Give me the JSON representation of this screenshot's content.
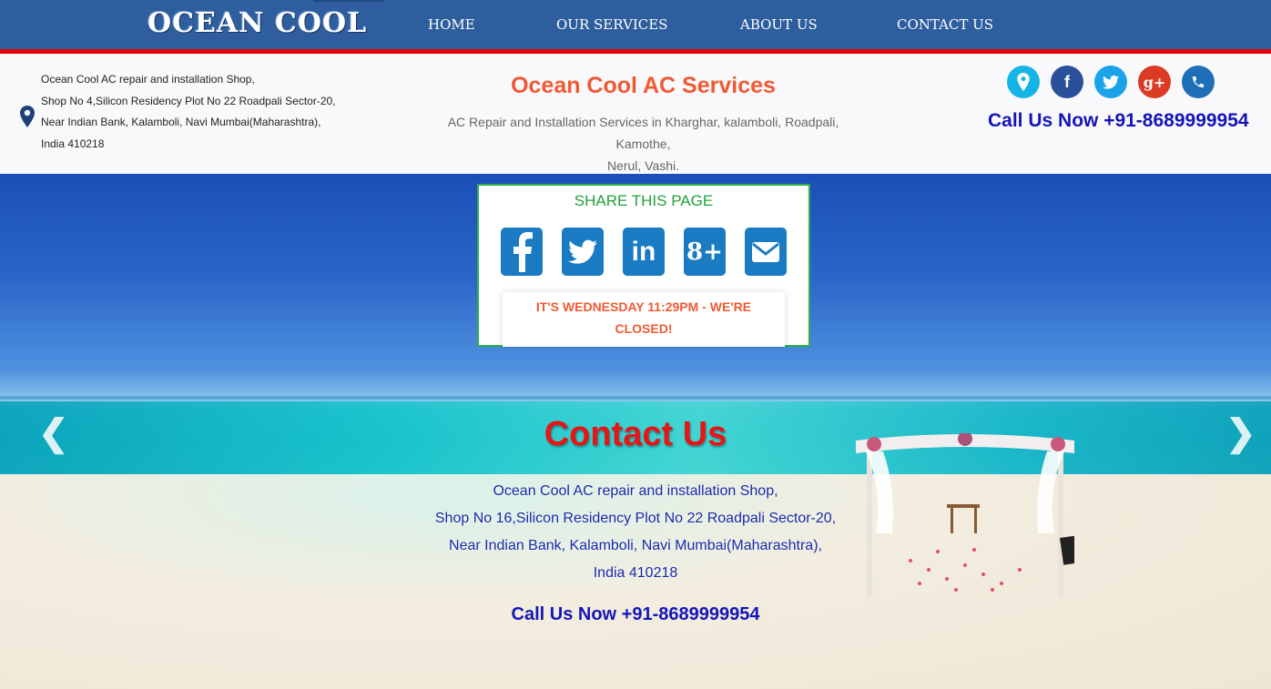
{
  "nav": {
    "logo": "OCEAN COOL",
    "items": [
      "HOME",
      "OUR SERVICES",
      "ABOUT US",
      "CONTACT US"
    ]
  },
  "info": {
    "address_lines": [
      "Ocean Cool AC repair and installation Shop,",
      "Shop No 4,Silicon Residency Plot No 22 Roadpali Sector-20,",
      "Near Indian Bank, Kalamboli, Navi Mumbai(Maharashtra),",
      "India 410218"
    ],
    "title": "Ocean Cool AC Services",
    "subtitle_line1": "AC Repair and Installation Services in Kharghar, kalamboli, Roadpali, Kamothe,",
    "subtitle_line2": "Nerul, Vashi.",
    "call": "Call Us Now +91-8689999954",
    "social_icons": [
      {
        "name": "location-icon",
        "color": "#14b4e6"
      },
      {
        "name": "facebook-icon",
        "color": "#2a4f9b"
      },
      {
        "name": "twitter-icon",
        "color": "#1aa3e8"
      },
      {
        "name": "google-plus-icon",
        "color": "#d93b24"
      },
      {
        "name": "phone-icon",
        "color": "#1f6fb8"
      }
    ]
  },
  "share": {
    "title": "SHARE THIS PAGE",
    "buttons": [
      "facebook-icon",
      "twitter-icon",
      "linkedin-icon",
      "google-plus-icon",
      "email-icon"
    ],
    "status_line1": "IT'S WEDNESDAY 11:29PM - WE'RE",
    "status_line2": "CLOSED!"
  },
  "contact": {
    "title": "Contact Us",
    "address_lines": [
      "Ocean Cool AC repair and installation Shop,",
      "Shop No 16,Silicon Residency Plot No 22 Roadpali Sector-20,",
      "Near Indian Bank, Kalamboli, Navi Mumbai(Maharashtra),",
      "India 410218"
    ],
    "call": "Call Us Now +91-8689999954"
  },
  "colors": {
    "nav_bg": "#2e5e9e",
    "accent_red": "#e00000",
    "title_orange": "#f05a33",
    "call_blue": "#1515b8",
    "share_green": "#2bb04a"
  }
}
